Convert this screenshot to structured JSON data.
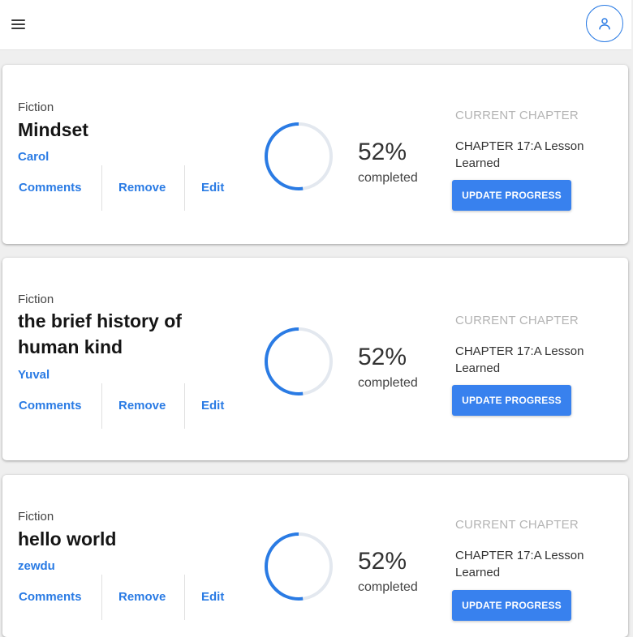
{
  "header": {
    "menu_icon": "hamburger-menu-icon",
    "account_icon": "user-account-icon"
  },
  "books": [
    {
      "genre": "Fiction",
      "title": "Mindset",
      "author": "Carol",
      "actions": {
        "comments": "Comments",
        "remove": "Remove",
        "edit": "Edit"
      },
      "progress_value": 52,
      "progress_text": "52%",
      "progress_label": "completed",
      "chapter_heading": "CURRENT CHAPTER",
      "chapter_name": "CHAPTER 17:A Lesson Learned",
      "update_label": "UPDATE PROGRESS"
    },
    {
      "genre": "Fiction",
      "title": "the brief history of human kind",
      "author": "Yuval",
      "actions": {
        "comments": "Comments",
        "remove": "Remove",
        "edit": "Edit"
      },
      "progress_value": 52,
      "progress_text": "52%",
      "progress_label": "completed",
      "chapter_heading": "CURRENT CHAPTER",
      "chapter_name": "CHAPTER 17:A Lesson Learned",
      "update_label": "UPDATE PROGRESS"
    },
    {
      "genre": "Fiction",
      "title": "hello world",
      "author": "zewdu",
      "actions": {
        "comments": "Comments",
        "remove": "Remove",
        "edit": "Edit"
      },
      "progress_value": 52,
      "progress_text": "52%",
      "progress_label": "completed",
      "chapter_heading": "CURRENT CHAPTER",
      "chapter_name": "CHAPTER 17:A Lesson Learned",
      "update_label": "UPDATE PROGRESS"
    }
  ],
  "colors": {
    "accent": "#2a7be4",
    "button": "#3881ee",
    "ring_track": "#e3e8ef",
    "page_background": "#efefef"
  }
}
